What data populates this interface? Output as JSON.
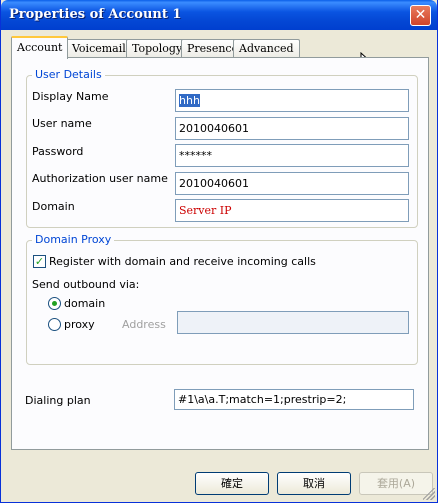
{
  "window": {
    "title": "Properties of Account 1",
    "close_glyph": "✕"
  },
  "tabs": [
    {
      "label": "Account",
      "active": true
    },
    {
      "label": "Voicemail",
      "active": false
    },
    {
      "label": "Topology",
      "active": false
    },
    {
      "label": "Presence",
      "active": false
    },
    {
      "label": "Advanced",
      "active": false
    }
  ],
  "user_details": {
    "legend": "User Details",
    "display_name": {
      "label": "Display Name",
      "value": "hhh"
    },
    "user_name": {
      "label": "User name",
      "value": "2010040601"
    },
    "password": {
      "label": "Password",
      "value": "******"
    },
    "auth_user_name": {
      "label": "Authorization user name",
      "value": "2010040601"
    },
    "domain": {
      "label": "Domain",
      "value": "Server IP"
    }
  },
  "domain_proxy": {
    "legend": "Domain Proxy",
    "register_checkbox": {
      "label": "Register with domain and receive incoming calls",
      "checked": true,
      "mark": "✓"
    },
    "send_outbound_label": "Send outbound via:",
    "option_domain": {
      "label": "domain",
      "checked": true
    },
    "option_proxy": {
      "label": "proxy",
      "checked": false
    },
    "address_label": "Address",
    "address_value": ""
  },
  "dialing_plan": {
    "label": "Dialing plan",
    "value": "#1\\a\\a.T;match=1;prestrip=2;"
  },
  "buttons": {
    "ok": "確定",
    "cancel": "取消",
    "apply": "套用(A)"
  },
  "colors": {
    "title_bar": "#0a54e1",
    "legend_text": "#0046d5",
    "domain_value": "#cc0000",
    "check_mark": "#21a121"
  }
}
